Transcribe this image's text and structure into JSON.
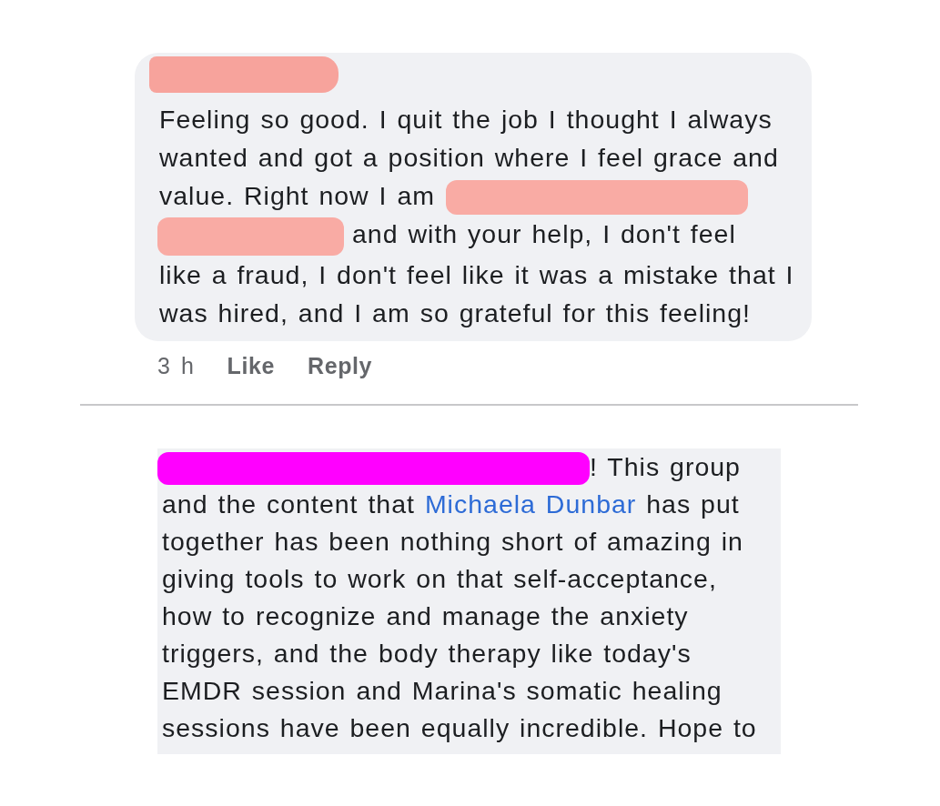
{
  "comments": [
    {
      "header": [
        {
          "kind": "redaction",
          "color": "#f7a39c"
        }
      ],
      "body": [
        {
          "kind": "text",
          "parts": [
            {
              "kind": "plain",
              "text": "Feeling so good. I quit the job I thought I always\nwanted and got a position where I feel grace and\nvalue. Right now I am"
            }
          ]
        },
        {
          "kind": "redaction",
          "color": "#f9aba4"
        },
        {
          "kind": "redaction",
          "color": "#f9aba4"
        },
        {
          "kind": "text",
          "parts": [
            {
              "kind": "plain",
              "text": "and with your help, I don't feel\nlike a fraud, I don't feel like it was a mistake that I\nwas hired, and I am so grateful for this feeling!"
            }
          ]
        }
      ],
      "meta": {
        "time": "3 h",
        "actions": [
          "Like",
          "Reply"
        ]
      }
    },
    {
      "body": [
        {
          "kind": "redaction",
          "color": "#ff00ff"
        },
        {
          "kind": "text",
          "parts": [
            {
              "kind": "plain",
              "text": "! This group\nand the content that "
            },
            {
              "kind": "link",
              "text": "Michaela Dunbar"
            },
            {
              "kind": "plain",
              "text": " has put\ntogether has been nothing short of amazing in\ngiving tools to work on that self-acceptance,\nhow to recognize and manage the anxiety\ntriggers, and the body therapy like today's\nEMDR session and Marina's somatic healing\nsessions have been equally incredible. Hope to"
            }
          ]
        }
      ]
    }
  ]
}
